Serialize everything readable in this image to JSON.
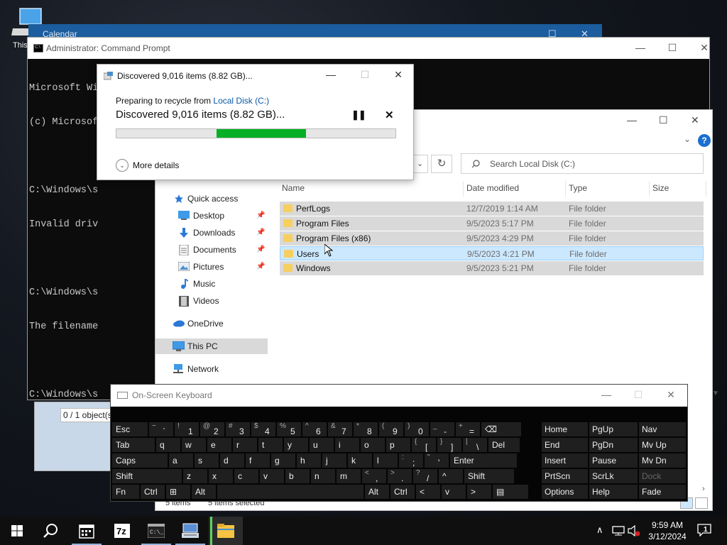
{
  "desktop": {
    "icon_label": "This"
  },
  "calendar": {
    "title": "Calendar"
  },
  "cmd": {
    "title": "Administrator: Command Prompt",
    "icon_text": "C:\\",
    "lines": [
      "Microsoft Windows [Version 10.0.19045.3324]",
      "(c) Microsof",
      "",
      "C:\\Windows\\s",
      "Invalid driv",
      "",
      "C:\\Windows\\s",
      "The filename",
      "",
      "C:\\Windows\\s"
    ]
  },
  "dialog": {
    "title": "Discovered 9,016 items (8.82 GB)...",
    "preparing_text": "Preparing to recycle from",
    "location_link": "Local Disk (C:)",
    "status": "Discovered 9,016 items (8.82 GB)...",
    "progress": {
      "start": 0.36,
      "end": 0.68
    },
    "more_details": "More details"
  },
  "explorer": {
    "search_placeholder": "Search Local Disk (C:)",
    "help": "?",
    "columns": [
      "Name",
      "Date modified",
      "Type",
      "Size"
    ],
    "nav": [
      {
        "label": "Quick access",
        "icon": "star-icon",
        "pinned": false
      },
      {
        "label": "Desktop",
        "icon": "desktop-icon",
        "pinned": true
      },
      {
        "label": "Downloads",
        "icon": "download-icon",
        "pinned": true
      },
      {
        "label": "Documents",
        "icon": "documents-icon",
        "pinned": true
      },
      {
        "label": "Pictures",
        "icon": "pictures-icon",
        "pinned": true
      },
      {
        "label": "Music",
        "icon": "music-icon",
        "pinned": false
      },
      {
        "label": "Videos",
        "icon": "videos-icon",
        "pinned": false
      },
      {
        "label": "OneDrive",
        "icon": "cloud-icon",
        "pinned": false
      },
      {
        "label": "This PC",
        "icon": "computer-icon",
        "pinned": false,
        "selected": true
      },
      {
        "label": "Network",
        "icon": "network-icon",
        "pinned": false
      }
    ],
    "files": [
      {
        "name": "PerfLogs",
        "date": "12/7/2019 1:14 AM",
        "type": "File folder"
      },
      {
        "name": "Program Files",
        "date": "9/5/2023 5:17 PM",
        "type": "File folder"
      },
      {
        "name": "Program Files (x86)",
        "date": "9/5/2023 4:29 PM",
        "type": "File folder"
      },
      {
        "name": "Users",
        "date": "9/5/2023 4:21 PM",
        "type": "File folder",
        "hover": true
      },
      {
        "name": "Windows",
        "date": "9/5/2023 5:21 PM",
        "type": "File folder"
      }
    ],
    "status_count": "5 items",
    "status_selected": "5 items selected"
  },
  "peek_dialog": {
    "text": "0 / 1 object(s"
  },
  "keyboard": {
    "title": "On-Screen Keyboard",
    "rows": [
      [
        {
          "m": "Esc"
        },
        {
          "s": "~",
          "b": "`"
        },
        {
          "s": "!",
          "b": "1"
        },
        {
          "s": "@",
          "b": "2"
        },
        {
          "s": "#",
          "b": "3"
        },
        {
          "s": "$",
          "b": "4"
        },
        {
          "s": "%",
          "b": "5"
        },
        {
          "s": "^",
          "b": "6"
        },
        {
          "s": "&",
          "b": "7"
        },
        {
          "s": "*",
          "b": "8"
        },
        {
          "s": "(",
          "b": "9"
        },
        {
          "s": ")",
          "b": "0"
        },
        {
          "s": "_",
          "b": "-"
        },
        {
          "s": "+",
          "b": "="
        },
        {
          "m": "⌫"
        }
      ],
      [
        {
          "m": "Tab"
        },
        {
          "m": "q"
        },
        {
          "m": "w"
        },
        {
          "m": "e"
        },
        {
          "m": "r"
        },
        {
          "m": "t"
        },
        {
          "m": "y"
        },
        {
          "m": "u"
        },
        {
          "m": "i"
        },
        {
          "m": "o"
        },
        {
          "m": "p"
        },
        {
          "s": "{",
          "b": "["
        },
        {
          "s": "}",
          "b": "]"
        },
        {
          "s": "|",
          "b": "\\"
        },
        {
          "m": "Del"
        }
      ],
      [
        {
          "m": "Caps"
        },
        {
          "m": "a"
        },
        {
          "m": "s"
        },
        {
          "m": "d"
        },
        {
          "m": "f"
        },
        {
          "m": "g"
        },
        {
          "m": "h"
        },
        {
          "m": "j"
        },
        {
          "m": "k"
        },
        {
          "m": "l"
        },
        {
          "s": ":",
          "b": ";"
        },
        {
          "s": "\"",
          "b": "'"
        },
        {
          "m": "Enter"
        }
      ],
      [
        {
          "m": "Shift"
        },
        {
          "m": "z"
        },
        {
          "m": "x"
        },
        {
          "m": "c"
        },
        {
          "m": "v"
        },
        {
          "m": "b"
        },
        {
          "m": "n"
        },
        {
          "m": "m"
        },
        {
          "s": "<",
          "b": ","
        },
        {
          "s": ">",
          "b": "."
        },
        {
          "s": "?",
          "b": "/"
        },
        {
          "m": "^"
        },
        {
          "m": "Shift"
        }
      ],
      [
        {
          "m": "Fn"
        },
        {
          "m": "Ctrl"
        },
        {
          "m": "⊞"
        },
        {
          "m": "Alt"
        },
        {
          "m": ""
        },
        {
          "m": "Alt"
        },
        {
          "m": "Ctrl"
        },
        {
          "m": "<"
        },
        {
          "m": "v"
        },
        {
          "m": ">"
        },
        {
          "m": "▤"
        }
      ]
    ],
    "right_keys": [
      [
        "Home",
        "PgUp",
        "Nav"
      ],
      [
        "End",
        "PgDn",
        "Mv Up"
      ],
      [
        "Insert",
        "Pause",
        "Mv Dn"
      ],
      [
        "PrtScn",
        "ScrLk",
        "Dock"
      ],
      [
        "Options",
        "Help",
        "Fade"
      ]
    ]
  },
  "taskbar": {
    "time": "9:59 AM",
    "date": "3/12/2024",
    "notification_count": "1",
    "apps": [
      "start-icon",
      "search-icon",
      "calendar-icon",
      "7zip-icon",
      "terminal-icon",
      "network-app-icon",
      "file-explorer-icon"
    ]
  },
  "colors": {
    "accent": "#06b025",
    "selection": "#cce8ff",
    "link": "#0b57a8"
  }
}
